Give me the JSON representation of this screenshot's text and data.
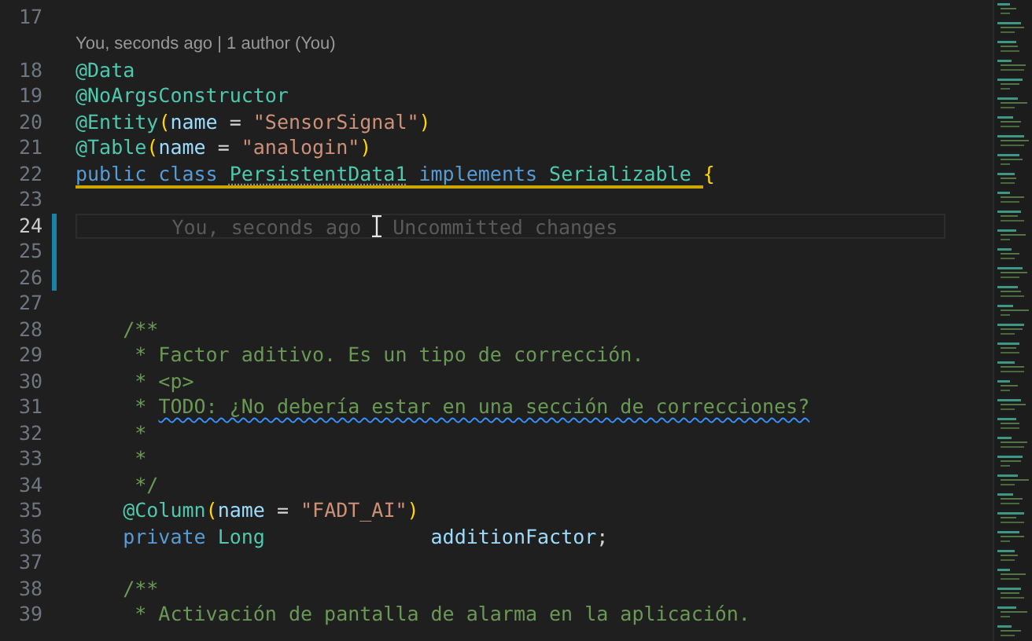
{
  "editor": {
    "lines": [
      {
        "kind": "code",
        "number": "17",
        "current": false,
        "modified": false
      },
      {
        "kind": "codelens",
        "text": "You, seconds ago | 1 author (You)"
      },
      {
        "kind": "code",
        "number": "18",
        "current": false,
        "modified": false,
        "tokens": [
          {
            "kind": "annotation",
            "text": "@Data"
          }
        ]
      },
      {
        "kind": "code",
        "number": "19",
        "current": false,
        "modified": false,
        "tokens": [
          {
            "kind": "annotation",
            "text": "@NoArgsConstructor"
          }
        ]
      },
      {
        "kind": "code",
        "number": "20",
        "current": false,
        "modified": false,
        "tokens": [
          {
            "kind": "annotation",
            "text": "@Entity"
          },
          {
            "kind": "paren",
            "text": "("
          },
          {
            "kind": "attr",
            "text": "name"
          },
          {
            "kind": "plain",
            "text": " = "
          },
          {
            "kind": "string",
            "text": "\"SensorSignal\""
          },
          {
            "kind": "paren",
            "text": ")"
          }
        ]
      },
      {
        "kind": "code",
        "number": "21",
        "current": false,
        "modified": false,
        "tokens": [
          {
            "kind": "annotation",
            "text": "@Table"
          },
          {
            "kind": "paren",
            "text": "("
          },
          {
            "kind": "attr",
            "text": "name"
          },
          {
            "kind": "plain",
            "text": " = "
          },
          {
            "kind": "string",
            "text": "\"analogin\""
          },
          {
            "kind": "paren",
            "text": ")"
          }
        ]
      },
      {
        "kind": "code",
        "number": "22",
        "current": false,
        "modified": false,
        "tokens": [
          {
            "kind": "keyword",
            "text": "public class ",
            "warning_underline": true,
            "dotted_underline": false
          },
          {
            "kind": "type",
            "text": "PersistentData1",
            "warning_underline": true,
            "dotted_underline": true
          },
          {
            "kind": "keyword",
            "text": " implements ",
            "warning_underline": true,
            "dotted_underline": false
          },
          {
            "kind": "type",
            "text": "Serializable ",
            "warning_underline": true,
            "dotted_underline": false
          },
          {
            "kind": "paren",
            "text": "{",
            "warning_underline": false,
            "dotted_underline": false
          }
        ]
      },
      {
        "kind": "code",
        "number": "23",
        "current": false,
        "modified": false
      },
      {
        "kind": "code",
        "number": "24",
        "current": true,
        "modified": true,
        "tokens": [
          {
            "kind": "ghost",
            "text": "        You, seconds ago"
          },
          {
            "kind": "ghost",
            "text": "Uncommitted changes"
          }
        ]
      },
      {
        "kind": "code",
        "number": "25",
        "current": false,
        "modified": true
      },
      {
        "kind": "code",
        "number": "26",
        "current": false,
        "modified": true
      },
      {
        "kind": "code",
        "number": "27",
        "current": false,
        "modified": false
      },
      {
        "kind": "code",
        "number": "28",
        "current": false,
        "modified": false,
        "tokens": [
          {
            "kind": "comment",
            "text": "    /**"
          }
        ]
      },
      {
        "kind": "code",
        "number": "29",
        "current": false,
        "modified": false,
        "tokens": [
          {
            "kind": "comment",
            "text": "     * Factor aditivo. Es un tipo de corrección."
          }
        ]
      },
      {
        "kind": "code",
        "number": "30",
        "current": false,
        "modified": false,
        "tokens": [
          {
            "kind": "comment",
            "text": "     * <p>"
          }
        ]
      },
      {
        "kind": "code",
        "number": "31",
        "current": false,
        "modified": false,
        "tokens": [
          {
            "kind": "comment",
            "text": "     * ",
            "wavy_underline": false
          },
          {
            "kind": "comment",
            "text": "TODO: ¿No debería estar en una sección de correcciones?",
            "wavy_underline": true
          }
        ]
      },
      {
        "kind": "code",
        "number": "32",
        "current": false,
        "modified": false,
        "tokens": [
          {
            "kind": "comment",
            "text": "     *"
          }
        ]
      },
      {
        "kind": "code",
        "number": "33",
        "current": false,
        "modified": false,
        "tokens": [
          {
            "kind": "comment",
            "text": "     *"
          }
        ]
      },
      {
        "kind": "code",
        "number": "34",
        "current": false,
        "modified": false,
        "tokens": [
          {
            "kind": "comment",
            "text": "     */"
          }
        ]
      },
      {
        "kind": "code",
        "number": "35",
        "current": false,
        "modified": false,
        "tokens": [
          {
            "kind": "annotation",
            "text": "    @Column"
          },
          {
            "kind": "paren",
            "text": "("
          },
          {
            "kind": "attr",
            "text": "name"
          },
          {
            "kind": "plain",
            "text": " = "
          },
          {
            "kind": "string",
            "text": "\"FADT_AI\""
          },
          {
            "kind": "paren",
            "text": ")"
          }
        ]
      },
      {
        "kind": "code",
        "number": "36",
        "current": false,
        "modified": false,
        "tokens": [
          {
            "kind": "keyword",
            "text": "    private "
          },
          {
            "kind": "type",
            "text": "Long              "
          },
          {
            "kind": "field",
            "text": "additionFactor"
          },
          {
            "kind": "plain",
            "text": ";"
          }
        ]
      },
      {
        "kind": "code",
        "number": "37",
        "current": false,
        "modified": false
      },
      {
        "kind": "code",
        "number": "38",
        "current": false,
        "modified": false,
        "tokens": [
          {
            "kind": "comment",
            "text": "    /**"
          }
        ]
      },
      {
        "kind": "code",
        "number": "39",
        "current": false,
        "modified": false,
        "tokens": [
          {
            "kind": "comment",
            "text": "     * Activación de pantalla de alarma en la aplicación."
          }
        ]
      }
    ]
  }
}
